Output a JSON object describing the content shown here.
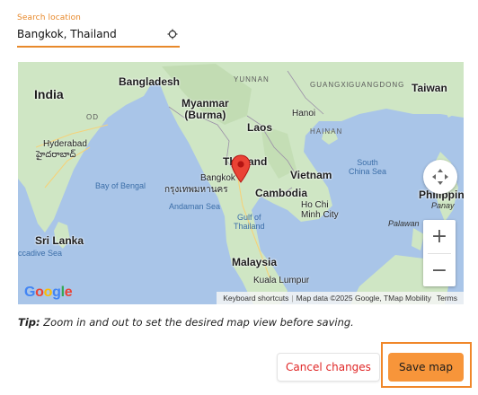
{
  "search": {
    "label": "Search location",
    "value": "Bangkok, Thailand",
    "locate_icon": "crosshair-icon"
  },
  "map": {
    "labels": {
      "india": "India",
      "bangladesh": "Bangladesh",
      "yunnan": "YUNNAN",
      "guangxi": "GUANGXI",
      "guangdong": "GUANGDONG",
      "taiwan": "Taiwan",
      "myanmar": "Myanmar\n(Burma)",
      "hanoi": "Hanoi",
      "laos": "Laos",
      "hainan": "HAINAN",
      "od": "OD",
      "hyderabad": "Hyderabad",
      "hyderabad_local": "హైదరాబాద్",
      "bangkok": "Bangkok",
      "bangkok_local": "กรุงเทพมหานคร",
      "thailand": "Thailand",
      "vietnam": "Vietnam",
      "south_china_sea": "South\nChina Sea",
      "bay_of_bengal": "Bay of Bengal",
      "cambodia": "Cambodia",
      "ho_chi_minh": "Ho Chi\nMinh City",
      "philippines": "Philippin",
      "panay": "Panay",
      "andaman_sea": "Andaman Sea",
      "gulf_of_thailand": "Gulf of\nThailand",
      "palawan": "Palawan",
      "sri_lanka": "Sri Lanka",
      "laccadive_sea": "ccadive Sea",
      "malaysia": "Malaysia",
      "kuala_lumpur": "Kuala Lumpur"
    },
    "google_logo": "Google",
    "attribution": {
      "shortcuts": "Keyboard shortcuts",
      "data": "Map data ©2025 Google, TMap Mobility",
      "terms": "Terms"
    },
    "zoom_in": "+",
    "zoom_out": "−"
  },
  "tip": {
    "prefix": "Tip:",
    "text": " Zoom in and out to set the desired map view before saving."
  },
  "actions": {
    "cancel_label": "Cancel changes",
    "save_label": "Save map"
  },
  "colors": {
    "accent": "#e8892b",
    "save_bg": "#f7953a",
    "cancel_text": "#e02626",
    "water": "#a9c5e8",
    "land": "#cfe6c4"
  }
}
